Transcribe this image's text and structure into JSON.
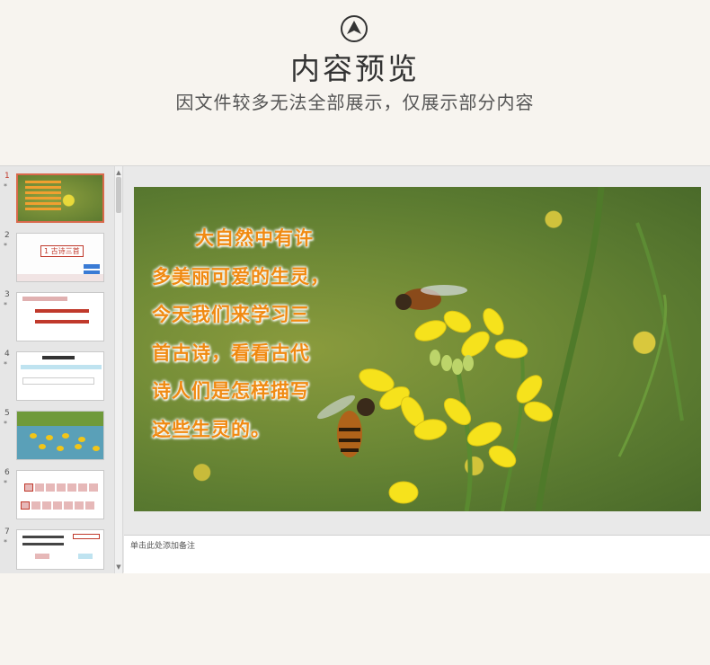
{
  "header": {
    "logo_icon": "upload-arrow-circle-icon",
    "title": "内容预览",
    "subtitle": "因文件较多无法全部展示，仅展示部分内容"
  },
  "thumbnails": [
    {
      "number": "1",
      "star": "*",
      "active": true
    },
    {
      "number": "2",
      "star": "*",
      "title": "1 古诗三首"
    },
    {
      "number": "3",
      "star": "*"
    },
    {
      "number": "4",
      "star": "*"
    },
    {
      "number": "5",
      "star": "*"
    },
    {
      "number": "6",
      "star": "*"
    },
    {
      "number": "7",
      "star": "*"
    }
  ],
  "slide": {
    "poem_lines": [
      "大自然中有许",
      "多美丽可爱的生灵，",
      "今天我们来学习三",
      "首古诗，看看古代",
      "诗人们是怎样描写",
      "这些生灵的。"
    ]
  },
  "notes": {
    "placeholder": "单击此处添加备注"
  },
  "colors": {
    "page_bg": "#f7f4ef",
    "poem_text": "#f08a12",
    "active_thumb_border": "#d9694b",
    "active_number": "#c0392b"
  }
}
